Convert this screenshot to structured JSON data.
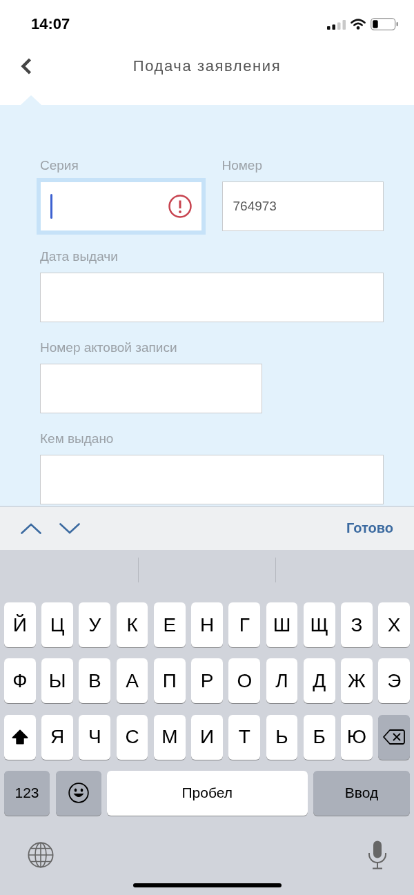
{
  "status_bar": {
    "time": "14:07"
  },
  "nav": {
    "title": "Подача заявления"
  },
  "form": {
    "rows": [
      {
        "fields": [
          {
            "label": "Серия",
            "focused": true,
            "error": true
          },
          {
            "label": "Номер",
            "value": "764973",
            "focused": false,
            "error": false
          }
        ]
      },
      {
        "fields": [
          {
            "label": "Дата выдачи",
            "focused": false,
            "error": false
          }
        ]
      },
      {
        "fields": [
          {
            "label": "Номер актовой записи",
            "focused": false,
            "error": false
          }
        ]
      },
      {
        "fields": [
          {
            "label": "Кем выдано",
            "focused": false,
            "error": false
          }
        ]
      }
    ]
  },
  "toolbar": {
    "done": "Готово"
  },
  "keyboard": {
    "rows": [
      {
        "keys": [
          {
            "kind": "letter",
            "label": "Й"
          },
          {
            "kind": "letter",
            "label": "Ц"
          },
          {
            "kind": "letter",
            "label": "У"
          },
          {
            "kind": "letter",
            "label": "К"
          },
          {
            "kind": "letter",
            "label": "Е"
          },
          {
            "kind": "letter",
            "label": "Н"
          },
          {
            "kind": "letter",
            "label": "Г"
          },
          {
            "kind": "letter",
            "label": "Ш"
          },
          {
            "kind": "letter",
            "label": "Щ"
          },
          {
            "kind": "letter",
            "label": "З"
          },
          {
            "kind": "letter",
            "label": "Х"
          }
        ]
      },
      {
        "keys": [
          {
            "kind": "letter",
            "label": "Ф"
          },
          {
            "kind": "letter",
            "label": "Ы"
          },
          {
            "kind": "letter",
            "label": "В"
          },
          {
            "kind": "letter",
            "label": "А"
          },
          {
            "kind": "letter",
            "label": "П"
          },
          {
            "kind": "letter",
            "label": "Р"
          },
          {
            "kind": "letter",
            "label": "О"
          },
          {
            "kind": "letter",
            "label": "Л"
          },
          {
            "kind": "letter",
            "label": "Д"
          },
          {
            "kind": "letter",
            "label": "Ж"
          },
          {
            "kind": "letter",
            "label": "Э"
          }
        ]
      },
      {
        "keys": [
          {
            "kind": "shift",
            "on": true
          },
          {
            "kind": "letter",
            "label": "Я"
          },
          {
            "kind": "letter",
            "label": "Ч"
          },
          {
            "kind": "letter",
            "label": "С"
          },
          {
            "kind": "letter",
            "label": "М"
          },
          {
            "kind": "letter",
            "label": "И"
          },
          {
            "kind": "letter",
            "label": "Т"
          },
          {
            "kind": "letter",
            "label": "Ь"
          },
          {
            "kind": "letter",
            "label": "Б"
          },
          {
            "kind": "letter",
            "label": "Ю"
          },
          {
            "kind": "backspace"
          }
        ]
      },
      {
        "keys": [
          {
            "kind": "numbers",
            "label": "123"
          },
          {
            "kind": "emoji"
          },
          {
            "kind": "space",
            "label": "Пробел"
          },
          {
            "kind": "return",
            "label": "Ввод"
          }
        ]
      }
    ]
  }
}
